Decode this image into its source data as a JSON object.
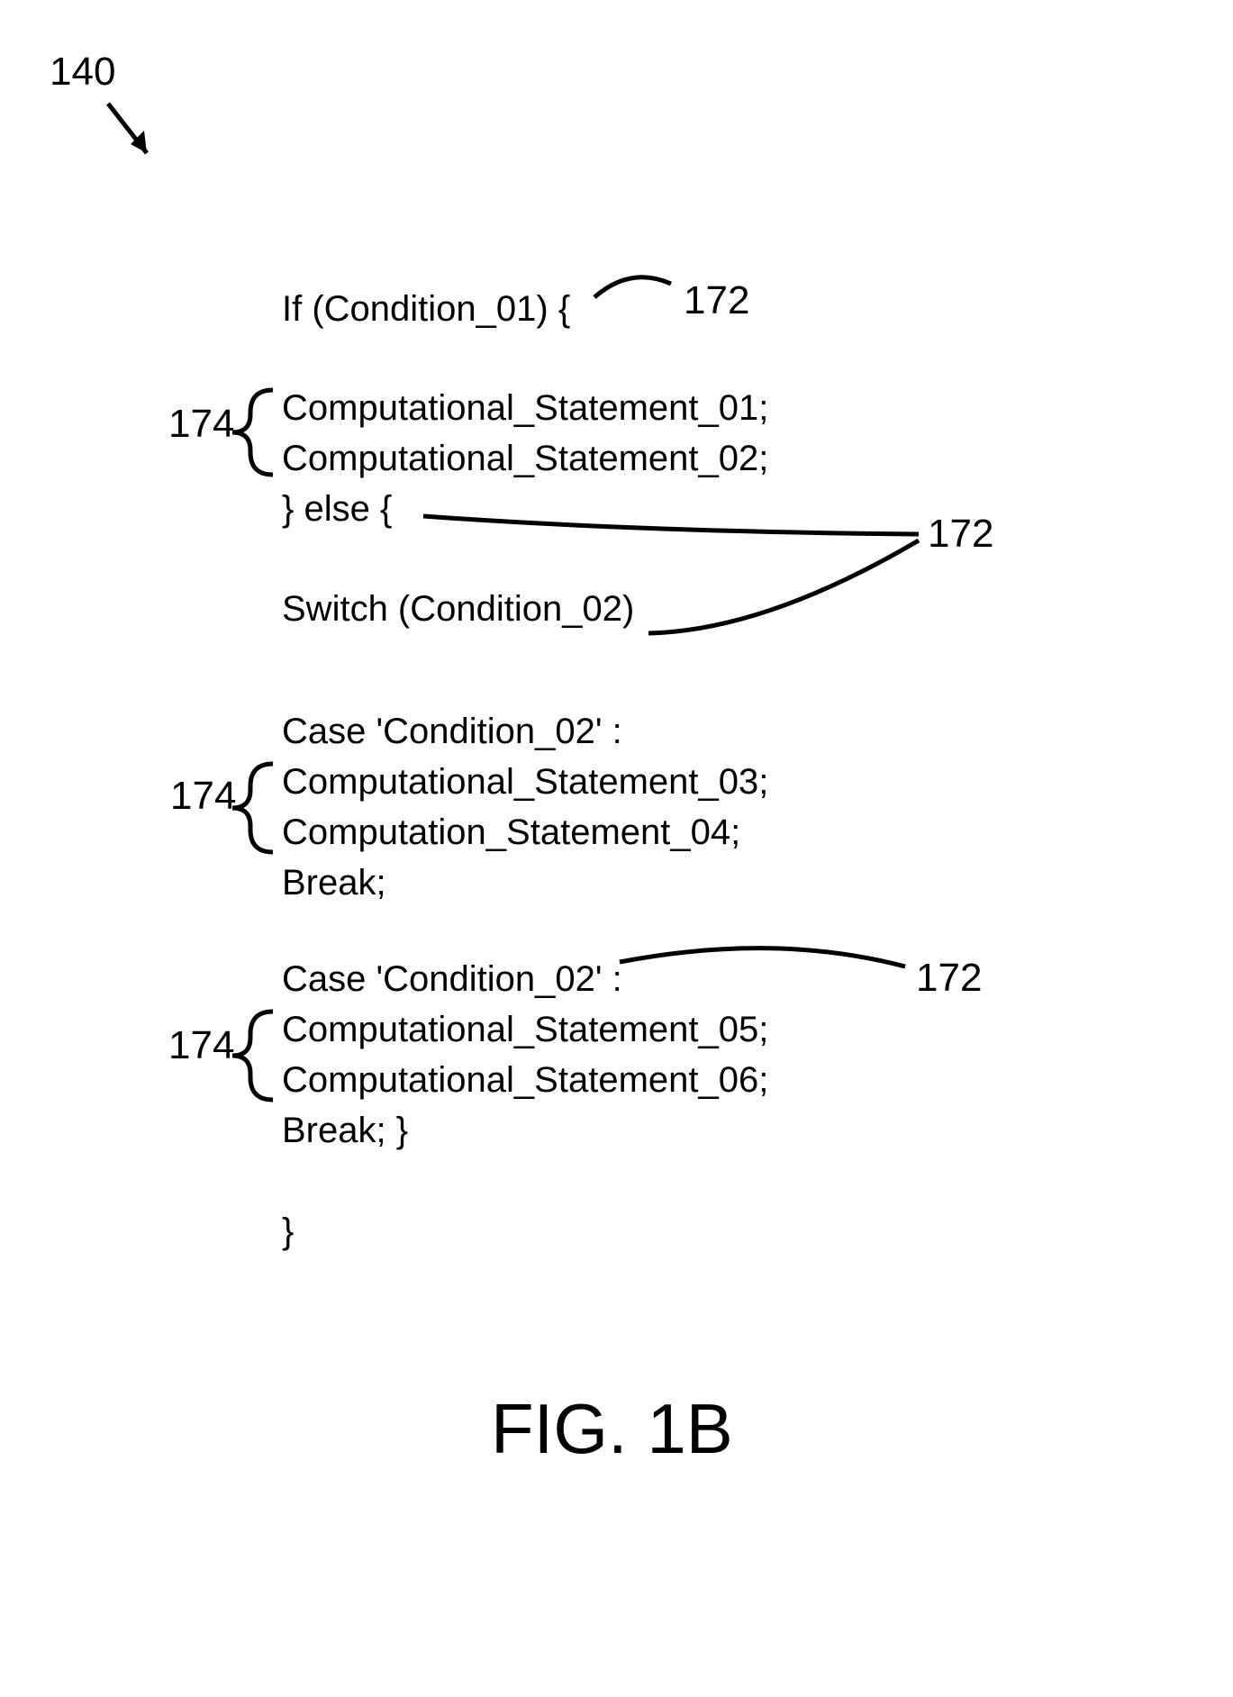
{
  "refs": {
    "r140": "140",
    "r172": "172",
    "r174": "174"
  },
  "code": {
    "line1": "If (Condition_01) {",
    "line2": "Computational_Statement_01;",
    "line3": "Computational_Statement_02;",
    "line4": "} else {",
    "line5": "Switch (Condition_02)",
    "line6": "Case 'Condition_02' :",
    "line7": "Computational_Statement_03;",
    "line8": "Computation_Statement_04;",
    "line9": "Break;",
    "line10": "Case 'Condition_02' :",
    "line11": "Computational_Statement_05;",
    "line12": "Computational_Statement_06;",
    "line13": "Break; }",
    "line14": "}"
  },
  "caption": "FIG. 1B"
}
